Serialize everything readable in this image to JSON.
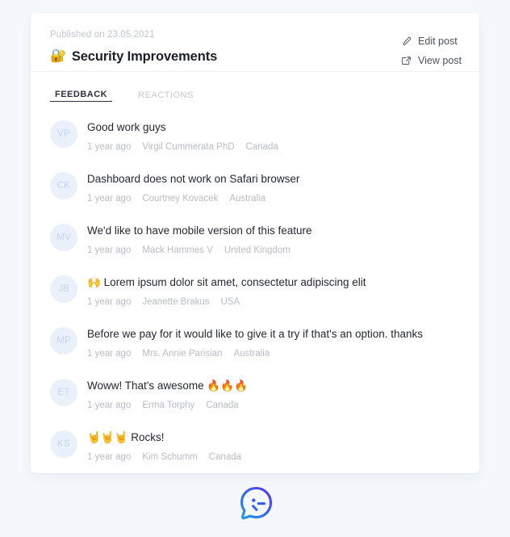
{
  "colors": {
    "page_background": "#f4f8fc",
    "card_background": "#ffffff",
    "text_primary": "#232833",
    "text_muted": "#b8bcc6",
    "avatar_background": "#eaf1fb",
    "avatar_text": "#c3d3ef",
    "tab_active": "#2b303b",
    "tab_inactive": "#c5c9d2",
    "launcher_gradient_start": "#2b9cf5",
    "launcher_gradient_end": "#5b3df5"
  },
  "header": {
    "published_label": "Published on 23.05.2021",
    "title_emoji": "🔐",
    "title": "Security Improvements",
    "actions": [
      {
        "label": "Edit post",
        "icon": "pencil-icon"
      },
      {
        "label": "View post",
        "icon": "external-link-icon"
      }
    ]
  },
  "tabs": [
    {
      "label": "FEEDBACK",
      "active": true
    },
    {
      "label": "REACTIONS",
      "active": false
    }
  ],
  "feedback": [
    {
      "initials": "VP",
      "emoji": "",
      "text": "Good work guys",
      "time": "1 year ago",
      "author": "Virgil Cummerata PhD",
      "country": "Canada"
    },
    {
      "initials": "CK",
      "emoji": "",
      "text": "Dashboard does not work on Safari browser",
      "time": "1 year ago",
      "author": "Courtney Kovacek",
      "country": "Australia"
    },
    {
      "initials": "MV",
      "emoji": "",
      "text": "We'd like to have mobile version of this feature",
      "time": "1 year ago",
      "author": "Mack Hammes V",
      "country": "United Kingdom"
    },
    {
      "initials": "JB",
      "emoji": "🙌",
      "text": "Lorem ipsum dolor sit amet, consectetur adipiscing elit",
      "time": "1 year ago",
      "author": "Jeanette Brakus",
      "country": "USA"
    },
    {
      "initials": "MP",
      "emoji": "",
      "text": "Before we pay for it would like to give it a try if that's an option. thanks",
      "time": "1 year ago",
      "author": "Mrs. Annie Parisian",
      "country": "Australia"
    },
    {
      "initials": "ET",
      "emoji": "",
      "text": "Woww! That's awesome 🔥🔥🔥",
      "time": "1 year ago",
      "author": "Erma Torphy",
      "country": "Canada"
    },
    {
      "initials": "KS",
      "emoji": "🤘🤘🤘",
      "text": "Rocks!",
      "time": "1 year ago",
      "author": "Kim Schumm",
      "country": "Canada"
    }
  ],
  "launcher": {
    "icon": "chat-bubble-icon",
    "label": "Open feedback widget"
  }
}
